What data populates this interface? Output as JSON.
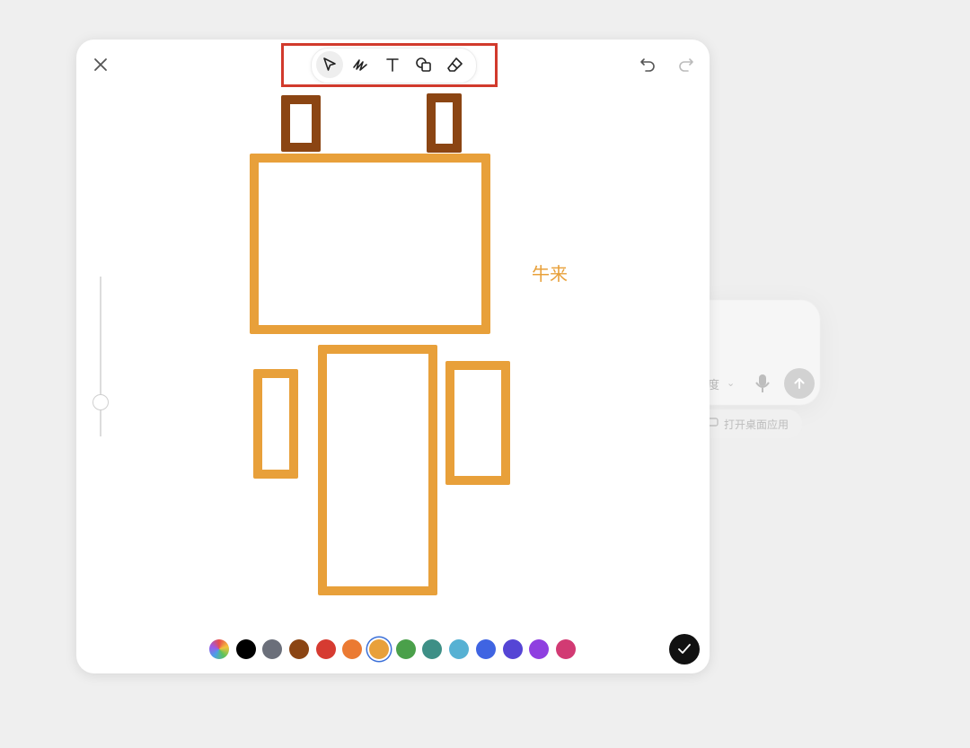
{
  "background": {
    "composer_text": "度",
    "open_desktop_app_label": "打开桌面应用"
  },
  "toolbar": {
    "tools": [
      {
        "name": "select",
        "icon": "cursor-arrow-icon",
        "active": true
      },
      {
        "name": "pen",
        "icon": "pen-scribble-icon",
        "active": false
      },
      {
        "name": "text",
        "icon": "text-T-icon",
        "active": false
      },
      {
        "name": "shapes",
        "icon": "shapes-icon",
        "active": false
      },
      {
        "name": "eraser",
        "icon": "eraser-icon",
        "active": false
      }
    ],
    "highlight_color": "#d13a2c"
  },
  "canvas": {
    "text_label": "牛来",
    "text_color": "#e8a03a",
    "shape_colors": {
      "brown": "#8b4513",
      "orange": "#e8a03a"
    }
  },
  "palette": {
    "colors": [
      "rainbow",
      "#000000",
      "#6b6f7a",
      "#8b4513",
      "#d63b31",
      "#eb7a32",
      "#e8a03a",
      "#4aa04a",
      "#3e8f86",
      "#56b1d3",
      "#3f64e2",
      "#5545d5",
      "#8f3fe0",
      "#d23a73"
    ],
    "selected_index": 6
  },
  "stroke_size_fraction": 0.25
}
